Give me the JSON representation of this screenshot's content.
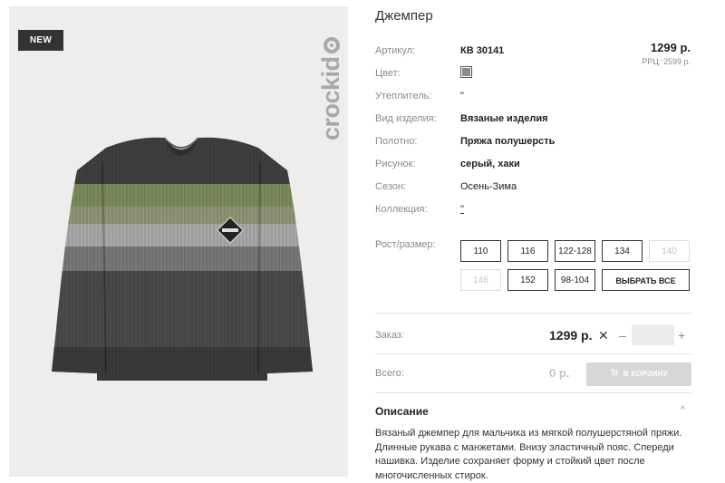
{
  "badge": "NEW",
  "brand": {
    "text": "crockid"
  },
  "product": {
    "title": "Джемпер",
    "price": "1299 р.",
    "rrp": "РРЦ: 2599 р.",
    "swatch_color": "#8a8a8a",
    "specs": [
      {
        "label": "Артикул:",
        "value": "КВ 30141"
      },
      {
        "label": "Цвет:",
        "value": ""
      },
      {
        "label": "Утеплитель:",
        "value": "\""
      },
      {
        "label": "Вид изделия:",
        "value": "Вязаные изделия"
      },
      {
        "label": "Полотно:",
        "value": "Пряжа полушерсть"
      },
      {
        "label": "Рисунок:",
        "value": "серый, хаки"
      },
      {
        "label": "Сезон:",
        "value": "Осень-Зима"
      },
      {
        "label": "Коллекция:",
        "value": "\""
      }
    ]
  },
  "sizes": {
    "label": "Рост/размер:",
    "row1": [
      "110",
      "116",
      "122-128",
      "134",
      "140"
    ],
    "row2": [
      "146",
      "152",
      "98-104"
    ],
    "select_all": "ВЫБРАТЬ ВСЕ"
  },
  "order": {
    "label": "Заказ:",
    "price": "1299 р.",
    "times": "✕",
    "minus": "–",
    "plus": "+",
    "quantity": ""
  },
  "total": {
    "label": "Всего:",
    "value": "0 р.",
    "cart_button": "В КОРЗИНУ"
  },
  "description": {
    "title": "Описание",
    "chevron": "^",
    "text": "Вязаный джемпер для мальчика из мягкой полушерстяной пряжи. Длинные рукава с манжетами. Внизу эластичный пояс. Спереди нашивка. Изделие сохраняет форму и стойкий цвет после многочисленных стирок."
  }
}
